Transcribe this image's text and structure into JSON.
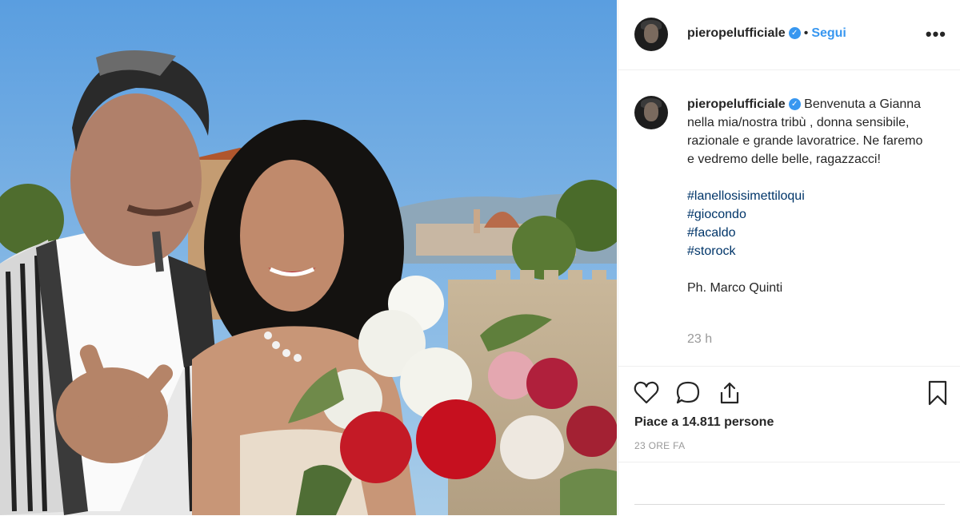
{
  "post": {
    "username": "pieropelufficiale",
    "verified_mark": "✓",
    "separator": "•",
    "follow_label": "Segui",
    "more_label": "•••",
    "caption": {
      "username": "pieropelufficiale",
      "text": "Benvenuta a Gianna nella mia/nostra tribù , donna sensibile, razionale e grande lavoratrice. Ne faremo e vedremo delle belle, ragazzacci!",
      "hashtags": [
        "#lanellosisimettiloqui",
        "#giocondo",
        "#facaldo",
        "#storock"
      ],
      "credit": "Ph. Marco Quinti",
      "time": "23 h"
    },
    "likes_text": "Piace a 14.811 persone",
    "posted_ago": "23 ORE FA",
    "icons": [
      "heart-icon",
      "comment-icon",
      "share-icon",
      "bookmark-icon",
      "verified-badge-icon",
      "more-options-icon"
    ],
    "colors": {
      "link_blue": "#3897f0",
      "hashtag": "#003569",
      "muted": "#999999",
      "border": "#efefef"
    }
  }
}
